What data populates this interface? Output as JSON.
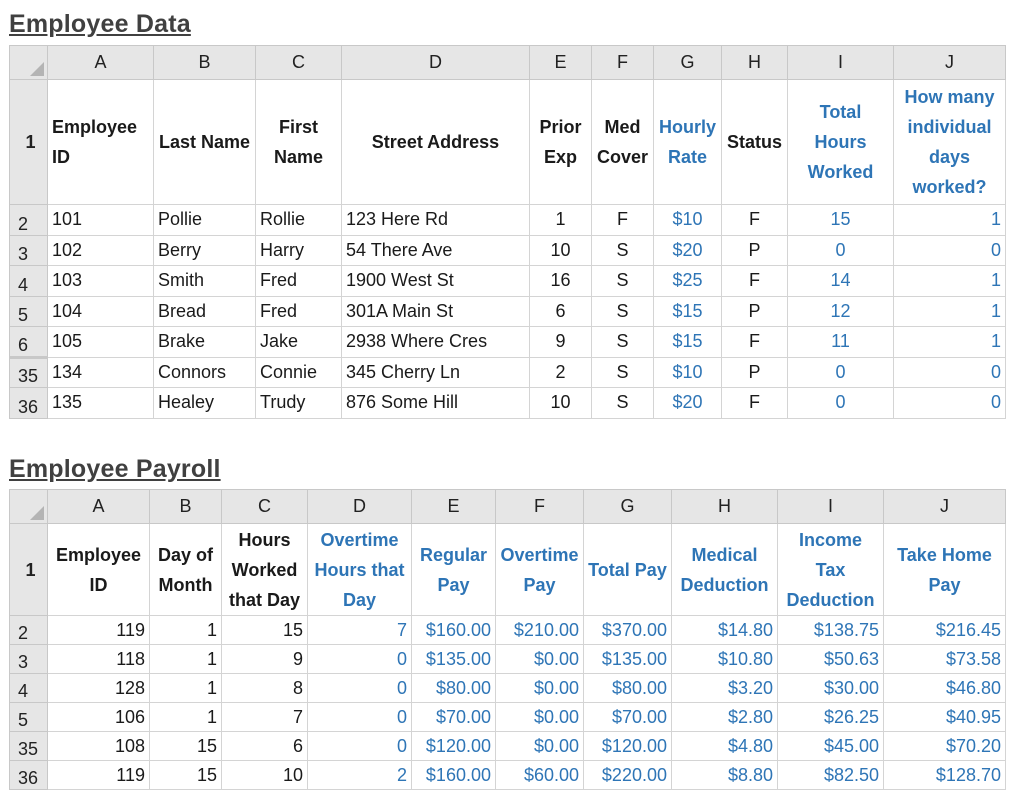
{
  "sheet1": {
    "title": "Employee Data",
    "columns": [
      "A",
      "B",
      "C",
      "D",
      "E",
      "F",
      "G",
      "H",
      "I",
      "J"
    ],
    "header_row_num": "1",
    "headers": [
      "Employee ID",
      "Last Name",
      "First Name",
      "Street Address",
      "Prior Exp",
      "Med Cover",
      "Hourly Rate",
      "Status",
      "Total Hours Worked",
      "How many individual days worked?"
    ],
    "rows": [
      {
        "num": "2",
        "cells": [
          "101",
          "Pollie",
          "Rollie",
          "123 Here Rd",
          "1",
          "F",
          "$10",
          "F",
          "15",
          "1"
        ]
      },
      {
        "num": "3",
        "cells": [
          "102",
          "Berry",
          "Harry",
          "54 There Ave",
          "10",
          "S",
          "$20",
          "P",
          "0",
          "0"
        ]
      },
      {
        "num": "4",
        "cells": [
          "103",
          "Smith",
          "Fred",
          "1900 West St",
          "16",
          "S",
          "$25",
          "F",
          "14",
          "1"
        ]
      },
      {
        "num": "5",
        "cells": [
          "104",
          "Bread",
          "Fred",
          "301A Main St",
          "6",
          "S",
          "$15",
          "P",
          "12",
          "1"
        ]
      },
      {
        "num": "6",
        "cells": [
          "105",
          "Brake",
          "Jake",
          "2938 Where Cres",
          "9",
          "S",
          "$15",
          "F",
          "11",
          "1"
        ]
      },
      {
        "num": "35",
        "cells": [
          "134",
          "Connors",
          "Connie",
          "345 Cherry Ln",
          "2",
          "S",
          "$10",
          "P",
          "0",
          "0"
        ]
      },
      {
        "num": "36",
        "cells": [
          "135",
          "Healey",
          "Trudy",
          "876 Some Hill",
          "10",
          "S",
          "$20",
          "F",
          "0",
          "0"
        ]
      }
    ]
  },
  "sheet2": {
    "title": "Employee Payroll",
    "columns": [
      "A",
      "B",
      "C",
      "D",
      "E",
      "F",
      "G",
      "H",
      "I",
      "J"
    ],
    "header_row_num": "1",
    "headers": [
      "Employee ID",
      "Day of Month",
      "Hours Worked that Day",
      "Overtime Hours that Day",
      "Regular Pay",
      "Overtime Pay",
      "Total Pay",
      "Medical Deduction",
      "Income Tax Deduction",
      "Take Home Pay"
    ],
    "rows": [
      {
        "num": "2",
        "cells": [
          "119",
          "1",
          "15",
          "7",
          "$160.00",
          "$210.00",
          "$370.00",
          "$14.80",
          "$138.75",
          "$216.45"
        ]
      },
      {
        "num": "3",
        "cells": [
          "118",
          "1",
          "9",
          "0",
          "$135.00",
          "$0.00",
          "$135.00",
          "$10.80",
          "$50.63",
          "$73.58"
        ]
      },
      {
        "num": "4",
        "cells": [
          "128",
          "1",
          "8",
          "0",
          "$80.00",
          "$0.00",
          "$80.00",
          "$3.20",
          "$30.00",
          "$46.80"
        ]
      },
      {
        "num": "5",
        "cells": [
          "106",
          "1",
          "7",
          "0",
          "$70.00",
          "$0.00",
          "$70.00",
          "$2.80",
          "$26.25",
          "$40.95"
        ]
      },
      {
        "num": "35",
        "cells": [
          "108",
          "15",
          "6",
          "0",
          "$120.00",
          "$0.00",
          "$120.00",
          "$4.80",
          "$45.00",
          "$70.20"
        ]
      },
      {
        "num": "36",
        "cells": [
          "119",
          "15",
          "10",
          "2",
          "$160.00",
          "$60.00",
          "$220.00",
          "$8.80",
          "$82.50",
          "$128.70"
        ]
      }
    ]
  },
  "colors": {
    "formula_blue": "#2e75b6",
    "header_gray": "#e6e6e6"
  }
}
